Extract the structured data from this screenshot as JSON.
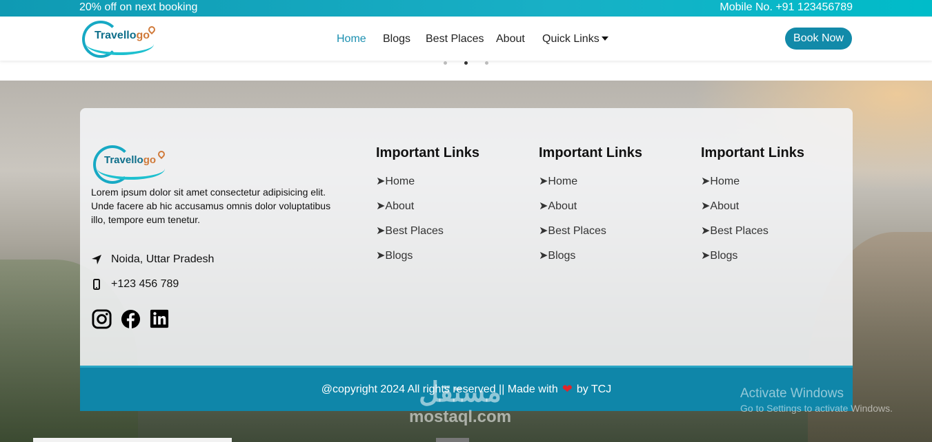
{
  "topbar": {
    "promo": "20% off on next booking",
    "mobile": "Mobile No. +91 123456789"
  },
  "brand": {
    "name_main": "Travello",
    "name_accent": "go"
  },
  "nav": {
    "items": [
      "Home",
      "Blogs",
      "Best Places",
      "About",
      "Quick Links"
    ],
    "active": "Home",
    "cta": "Book Now"
  },
  "carousel": {
    "slides": 3,
    "active": 2
  },
  "footer": {
    "about": "Lorem ipsum dolor sit amet consectetur adipisicing elit. Unde facere ab hic accusamus omnis dolor voluptatibus illo, tempore eum tenetur.",
    "location": "Noida, Uttar Pradesh",
    "phone": "+123 456 789",
    "socials": [
      "instagram-icon",
      "facebook-icon",
      "linkedin-icon"
    ],
    "columns": [
      {
        "title": "Important Links",
        "links": [
          "Home",
          "About",
          "Best Places",
          "Blogs"
        ]
      },
      {
        "title": "Important Links",
        "links": [
          "Home",
          "About",
          "Best Places",
          "Blogs"
        ]
      },
      {
        "title": "Important Links",
        "links": [
          "Home",
          "About",
          "Best Places",
          "Blogs"
        ]
      }
    ],
    "link_prefix": "➤"
  },
  "copyright": {
    "before": "@copyright 2024 All rights reserved || Made with",
    "after": "by TCJ",
    "accent": "#e0242a"
  },
  "os_overlay": {
    "line1": "Activate Windows",
    "line2": "Go to Settings to activate Windows."
  },
  "watermark": {
    "arabic": "مستقل",
    "latin": "mostaql.com"
  },
  "colors": {
    "primary": "#128aa9",
    "topbar": "#18b0c6"
  }
}
